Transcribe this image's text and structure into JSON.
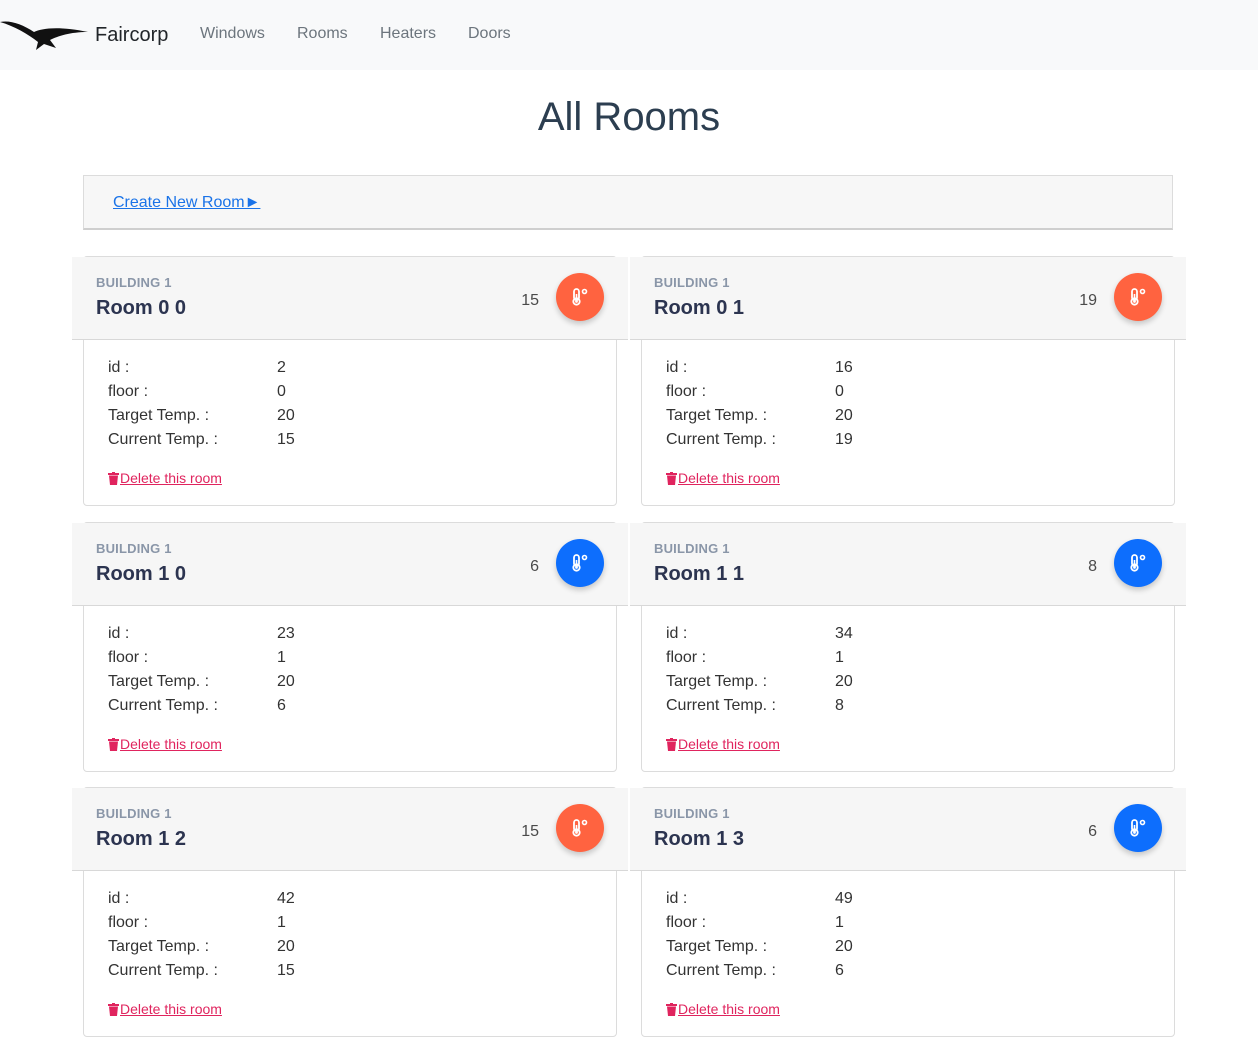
{
  "nav": {
    "brand": "Faircorp",
    "links": [
      "Windows",
      "Rooms",
      "Heaters",
      "Doors"
    ]
  },
  "page": {
    "title": "All Rooms",
    "create_link": "Create New Room►"
  },
  "labels": {
    "id": "id :",
    "floor": "floor :",
    "target": "Target Temp. :",
    "current": "Current Temp. :",
    "delete": "Delete this room"
  },
  "colors": {
    "warm": "#ff6340",
    "cold": "#0d6efd"
  },
  "rooms": [
    {
      "building": "BUILDING 1",
      "name": "Room 0 0",
      "temp": "15",
      "id": "2",
      "floor": "0",
      "target": "20",
      "current": "15",
      "status": "warm",
      "icon": "thermometer-icon"
    },
    {
      "building": "BUILDING 1",
      "name": "Room 0 1",
      "temp": "19",
      "id": "16",
      "floor": "0",
      "target": "20",
      "current": "19",
      "status": "warm",
      "icon": "thermometer-icon"
    },
    {
      "building": "BUILDING 1",
      "name": "Room 1 0",
      "temp": "6",
      "id": "23",
      "floor": "1",
      "target": "20",
      "current": "6",
      "status": "cold",
      "icon": "thermometer-icon"
    },
    {
      "building": "BUILDING 1",
      "name": "Room 1 1",
      "temp": "8",
      "id": "34",
      "floor": "1",
      "target": "20",
      "current": "8",
      "status": "cold",
      "icon": "thermometer-icon"
    },
    {
      "building": "BUILDING 1",
      "name": "Room 1 2",
      "temp": "15",
      "id": "42",
      "floor": "1",
      "target": "20",
      "current": "15",
      "status": "warm",
      "icon": "thermometer-icon"
    },
    {
      "building": "BUILDING 1",
      "name": "Room 1 3",
      "temp": "6",
      "id": "49",
      "floor": "1",
      "target": "20",
      "current": "6",
      "status": "cold",
      "icon": "thermometer-icon"
    }
  ]
}
